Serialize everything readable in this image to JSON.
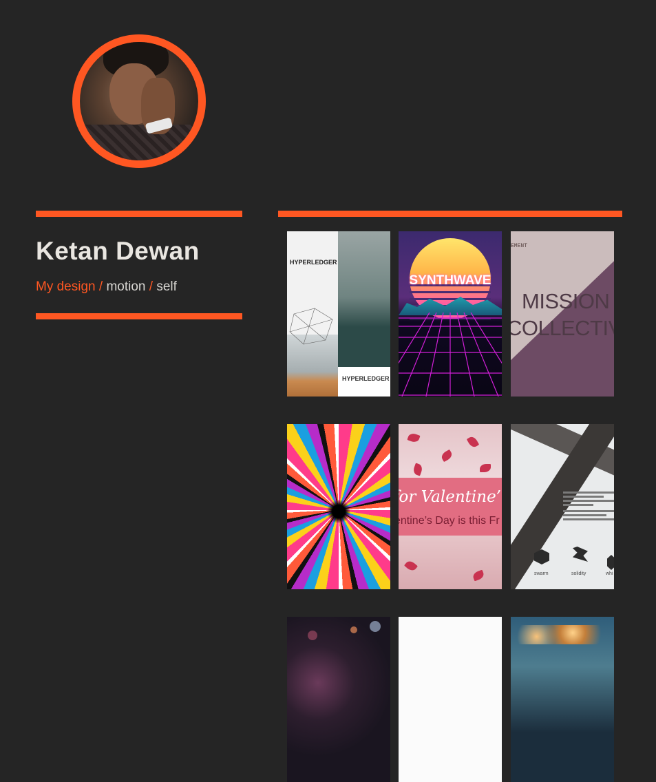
{
  "profile": {
    "name": "Ketan Dewan",
    "avatar_icon": "avatar-photo"
  },
  "breadcrumb": {
    "item1": "My design",
    "sep1": " / ",
    "item2": "motion",
    "sep2": " / ",
    "item3": "self"
  },
  "colors": {
    "accent": "#ff5722",
    "background": "#252525",
    "name_text": "#e9e6e1"
  },
  "gallery": {
    "tiles": [
      {
        "id": "hyperledger",
        "text1": "HYPERLEDGER",
        "text2": "HYPERLEDGER"
      },
      {
        "id": "synthwave",
        "title": "SYNTHWAVE"
      },
      {
        "id": "mission-collective",
        "small": "EMENT",
        "line1": "MISSION",
        "line2": "COLLECTIVE"
      },
      {
        "id": "swirl"
      },
      {
        "id": "valentine",
        "line1": "for Valentine’",
        "line2": "entine’s Day is this Fr"
      },
      {
        "id": "swarm",
        "cap1": "swarm",
        "cap2": "solidity",
        "cap3": "whi"
      },
      {
        "id": "bokeh"
      },
      {
        "id": "white"
      },
      {
        "id": "earth-night"
      }
    ]
  }
}
